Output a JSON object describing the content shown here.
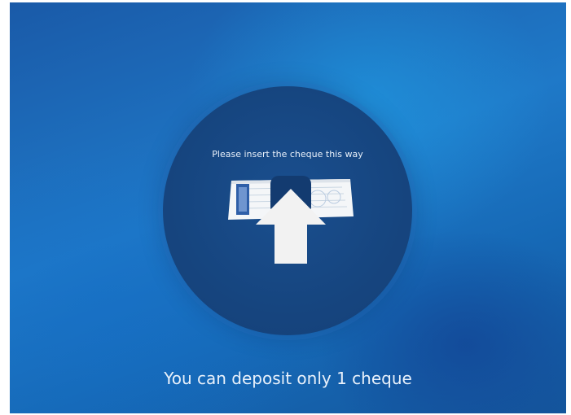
{
  "instruction": "Please insert the cheque this way",
  "footer": "You can deposit only 1 cheque",
  "colors": {
    "background_primary": "#1f79c8",
    "circle": "#16457f",
    "arrow": "#f2f2f2",
    "text": "#e9f1fb"
  },
  "icons": {
    "cheque": "cheque-icon",
    "arrow": "arrow-up-icon"
  }
}
